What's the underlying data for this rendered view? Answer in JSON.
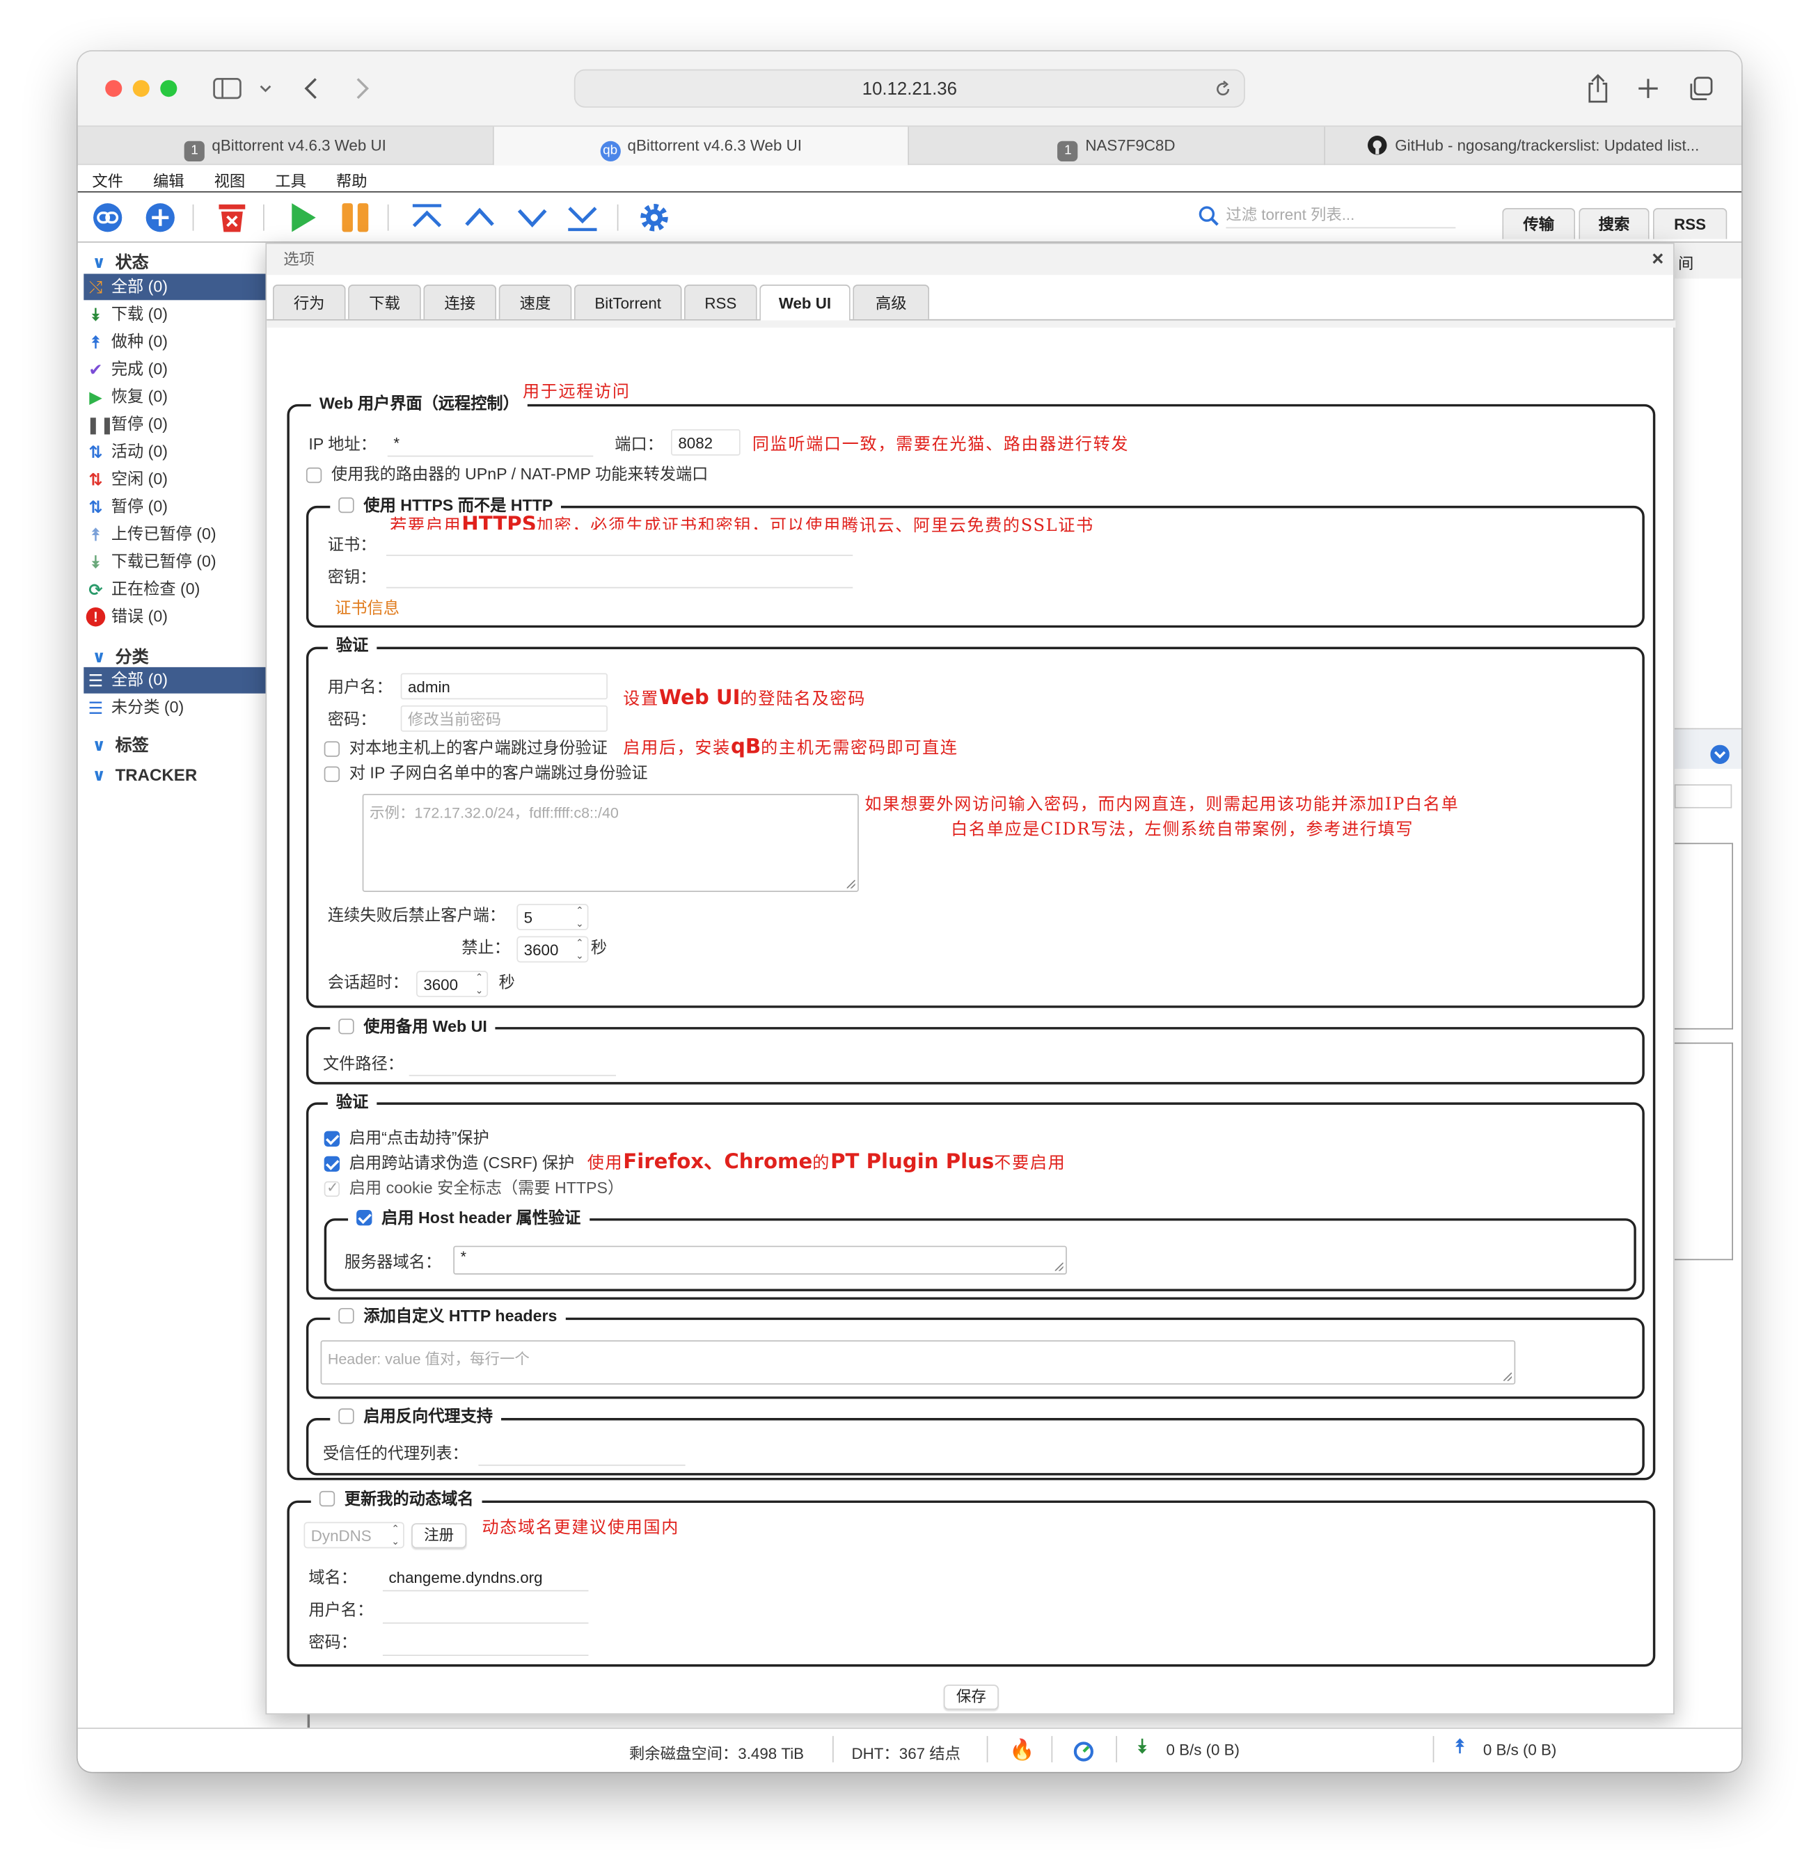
{
  "browser": {
    "url": "10.12.21.36",
    "tabs": [
      {
        "badge": "1",
        "title": "qBittorrent v4.6.3 Web UI"
      },
      {
        "badge": "qb",
        "title": "qBittorrent v4.6.3 Web UI"
      },
      {
        "badge": "1",
        "title": "NAS7F9C8D"
      },
      {
        "badge": "",
        "title": "GitHub - ngosang/trackerslist: Updated list..."
      }
    ]
  },
  "menu": [
    "文件",
    "编辑",
    "视图",
    "工具",
    "帮助"
  ],
  "toolbar": {
    "filter_placeholder": "过滤 torrent 列表...",
    "right_tabs": [
      "传输",
      "搜索",
      "RSS"
    ]
  },
  "sidebar": {
    "status_header": "状态",
    "status_items": [
      "全部 (0)",
      "下载 (0)",
      "做种 (0)",
      "完成 (0)",
      "恢复 (0)",
      "暂停 (0)",
      "活动 (0)",
      "空闲 (0)",
      "暂停 (0)",
      "上传已暂停 (0)",
      "下载已暂停 (0)",
      "正在检查 (0)",
      "错误 (0)"
    ],
    "category_header": "分类",
    "category_items": [
      "全部 (0)",
      "未分类 (0)"
    ],
    "tags_header": "标签",
    "tracker_header": "TRACKER"
  },
  "background_text": "间",
  "dialog": {
    "title": "选项",
    "close": "×",
    "tabs": [
      "行为",
      "下载",
      "连接",
      "速度",
      "BitTorrent",
      "RSS",
      "Web UI",
      "高级"
    ],
    "webui": {
      "legend": "Web 用户界面（远程控制）",
      "ip_label": "IP 地址：",
      "ip_value": "*",
      "port_label": "端口：",
      "port_value": "8082",
      "upnp_label": "使用我的路由器的 UPnP / NAT-PMP 功能来转发端口"
    },
    "https": {
      "legend": "使用 HTTPS 而不是 HTTP",
      "cert_label": "证书：",
      "key_label": "密钥：",
      "cert_info": "证书信息"
    },
    "auth": {
      "legend": "验证",
      "user_label": "用户名：",
      "user_value": "admin",
      "pass_label": "密码：",
      "pass_placeholder": "修改当前密码",
      "bypass_local": "对本地主机上的客户端跳过身份验证",
      "bypass_subnet": "对 IP 子网白名单中的客户端跳过身份验证",
      "subnet_placeholder": "示例：172.17.32.0/24，fdff:ffff:c8::/40",
      "ban_after_label": "连续失败后禁止客户端：",
      "ban_after_value": "5",
      "ban_label": "禁止：",
      "ban_value": "3600",
      "sec": "秒",
      "session_label": "会话超时：",
      "session_value": "3600"
    },
    "alt_webui": {
      "legend": "使用备用 Web UI",
      "path_label": "文件路径："
    },
    "security": {
      "legend": "验证",
      "clickjack": "启用“点击劫持”保护",
      "csrf": "启用跨站请求伪造 (CSRF) 保护",
      "cookie": "启用 cookie 安全标志（需要 HTTPS）",
      "host_legend": "启用 Host header 属性验证",
      "domain_label": "服务器域名：",
      "domain_value": "*"
    },
    "custom_headers": {
      "legend": "添加自定义 HTTP headers",
      "placeholder": "Header: value 值对，每行一个"
    },
    "reverse_proxy": {
      "legend": "启用反向代理支持",
      "trusted_label": "受信任的代理列表："
    },
    "ddns": {
      "legend": "更新我的动态域名",
      "service": "DynDNS",
      "register": "注册",
      "domain_label": "域名：",
      "domain_value": "changeme.dyndns.org",
      "user_label": "用户名：",
      "pass_label": "密码："
    },
    "save": "保存"
  },
  "annotations": {
    "remote": "用于远程访问",
    "port": "同监听端口一致，需要在光猫、路由器进行转发",
    "https_a": "若要启用",
    "https_b": "HTTPS",
    "https_c": "加密，必须生成证书和密钥，可以使用腾讯云、阿里云免费的SSL证书",
    "login_a": "设置",
    "login_b": "Web UI",
    "login_c": "的登陆名及密码",
    "local_a": "启用后，安装",
    "local_b": "qB",
    "local_c": "的主机无需密码即可直连",
    "whitelist1": "如果想要外网访问输入密码，而内网直连，则需起用该功能并添加IP白名单",
    "whitelist2": "白名单应是CIDR写法，左侧系统自带案例，参考进行填写",
    "csrf_a": "使用",
    "csrf_b": "Firefox、Chrome",
    "csrf_c": "的",
    "csrf_d": "PT Plugin Plus",
    "csrf_e": "不要启用",
    "ddns": "动态域名更建议使用国内"
  },
  "statusbar": {
    "disk": "剩余磁盘空间：3.498 TiB",
    "dht": "DHT：367 结点",
    "down": "0 B/s (0 B)",
    "up": "0 B/s (0 B)"
  },
  "colors": {
    "accent": "#2d72d9",
    "selection": "#3e5c8e",
    "annotation": "#e0211c",
    "start": "#2fb44a",
    "pause": "#f29b2e",
    "delete": "#e0322b"
  }
}
